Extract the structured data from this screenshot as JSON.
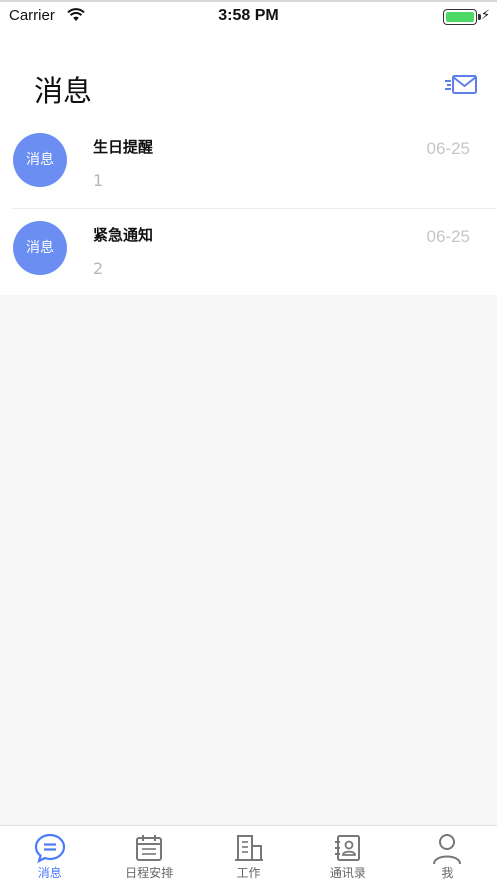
{
  "status_bar": {
    "carrier": "Carrier",
    "time": "3:58 PM"
  },
  "header": {
    "title": "消息",
    "compose_icon": "mail-send-icon"
  },
  "messages": [
    {
      "avatar_text": "消息",
      "title": "生日提醒",
      "preview": "1",
      "date": "06-25"
    },
    {
      "avatar_text": "消息",
      "title": "紧急通知",
      "preview": "2",
      "date": "06-25"
    }
  ],
  "tabs": [
    {
      "label": "消息",
      "icon": "chat-bubble-icon",
      "active": true
    },
    {
      "label": "日程安排",
      "icon": "calendar-icon",
      "active": false
    },
    {
      "label": "工作",
      "icon": "building-icon",
      "active": false
    },
    {
      "label": "通讯录",
      "icon": "contacts-book-icon",
      "active": false
    },
    {
      "label": "我",
      "icon": "person-icon",
      "active": false
    }
  ],
  "colors": {
    "accent": "#4a7bff",
    "avatar": "#6b8ef2",
    "battery": "#4cd964",
    "background": "#f6f6f6"
  }
}
